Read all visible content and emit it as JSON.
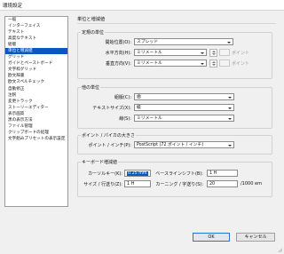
{
  "window": {
    "title": "環境設定"
  },
  "sidebar": {
    "items": [
      {
        "label": "一般"
      },
      {
        "label": "インターフェイス"
      },
      {
        "label": "テキスト"
      },
      {
        "label": "高度なテキスト"
      },
      {
        "label": "組版"
      },
      {
        "label": "単位と増減値"
      },
      {
        "label": "グリッド"
      },
      {
        "label": "ガイドとペーストボード"
      },
      {
        "label": "文字枠グリッド"
      },
      {
        "label": "欧文辞書"
      },
      {
        "label": "欧文スペルチェック"
      },
      {
        "label": "自動修正"
      },
      {
        "label": "注釈"
      },
      {
        "label": "変更トラック"
      },
      {
        "label": "ストーリーエディター"
      },
      {
        "label": "表示画質"
      },
      {
        "label": "黒の表示方法"
      },
      {
        "label": "ファイル管理"
      },
      {
        "label": "クリップボードの処理"
      },
      {
        "label": "文字組みプリセットの表示設定"
      }
    ],
    "selected_index": 5
  },
  "main": {
    "heading": "単位と増減値",
    "ruler_units": {
      "title": "定規の単位",
      "origin_label": "開始位置(O):",
      "origin_value": "スプレッド",
      "horizontal_label": "水平方向(H):",
      "horizontal_value": "ミリメートル",
      "horizontal_points": "ポイント",
      "vertical_label": "垂直方向(V):",
      "vertical_value": "ミリメートル",
      "vertical_points": "ポイント"
    },
    "other_units": {
      "title": "他の単位",
      "stroke_label": "組版(C):",
      "stroke_value": "歯",
      "textsize_label": "テキストサイズ(X):",
      "textsize_value": "級",
      "line_label": "線(S):",
      "line_value": "ミリメートル"
    },
    "points_pica": {
      "title": "ポイント / パイカの大きさ",
      "label": "ポイント / インチ(P):",
      "value": "PostScript (72 ポイント / インチ)"
    },
    "keyboard_increments": {
      "title": "キーボード増減値",
      "cursor_label": "カーソルキー(K):",
      "cursor_value": "0.25 mm",
      "baseline_label": "ベースラインシフト(B):",
      "baseline_value": "1 H",
      "size_label": "サイズ / 行送り(Z):",
      "size_value": "1 H",
      "kerning_label": "カーニング / 字送り(S):",
      "kerning_value": "20",
      "kerning_unit": "/1000 em"
    }
  },
  "buttons": {
    "ok": "OK",
    "cancel": "キャンセル"
  }
}
